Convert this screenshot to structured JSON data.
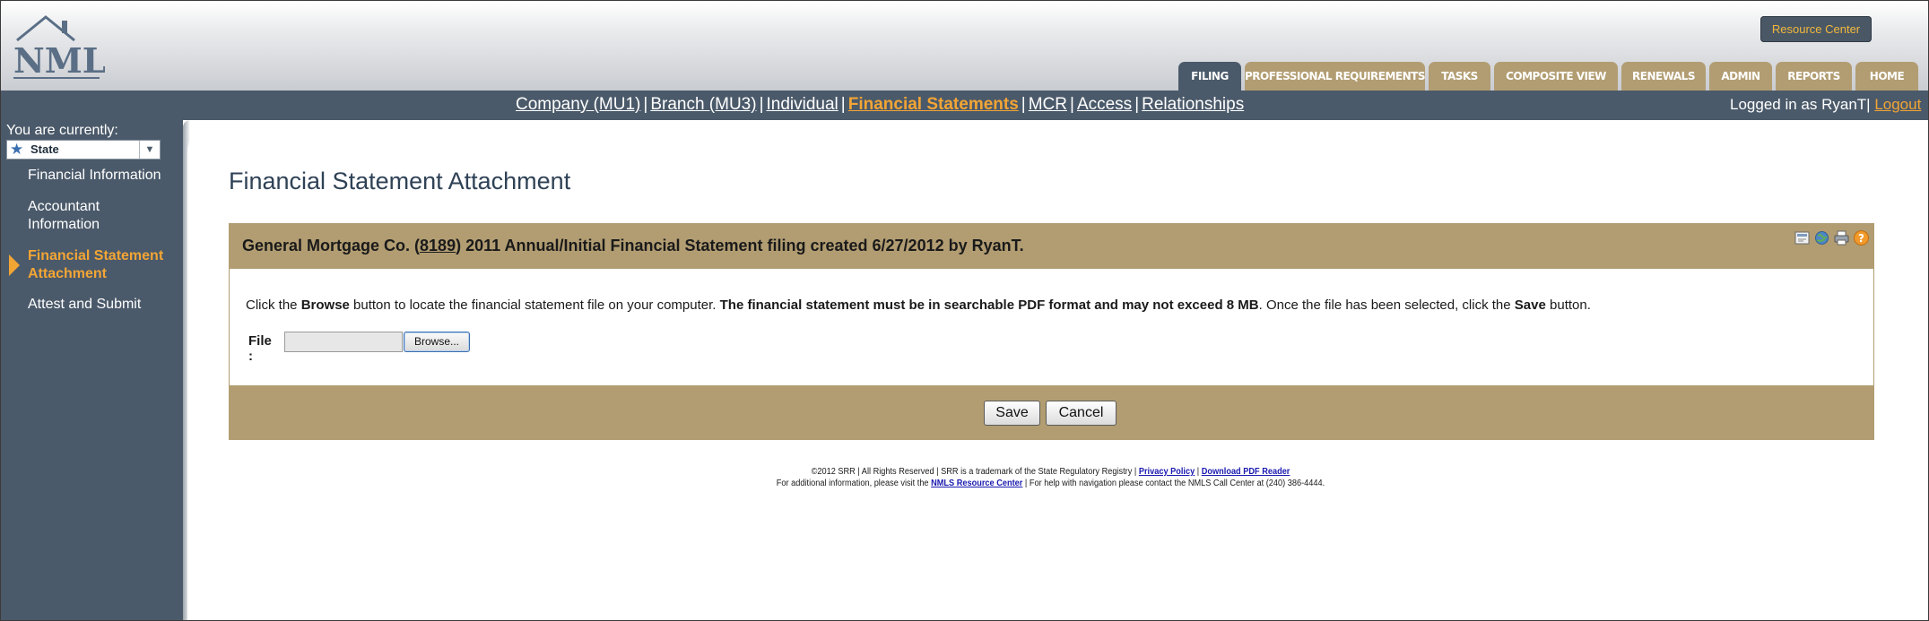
{
  "header": {
    "logo_text": "NMLS",
    "resource_center": "Resource Center",
    "tabs": [
      {
        "label": "FILING",
        "active": true
      },
      {
        "label": "PROFESSIONAL REQUIREMENTS"
      },
      {
        "label": "TASKS"
      },
      {
        "label": "COMPOSITE VIEW"
      },
      {
        "label": "RENEWALS"
      },
      {
        "label": "ADMIN"
      },
      {
        "label": "REPORTS"
      },
      {
        "label": "HOME"
      }
    ]
  },
  "subnav": {
    "items": [
      "Company (MU1)",
      "Branch (MU3)",
      "Individual",
      "Financial Statements",
      "MCR",
      "Access",
      "Relationships"
    ],
    "current": "Financial Statements",
    "separator": "|"
  },
  "login": {
    "text": "Logged in as RyanT",
    "separator": "|",
    "logout": "Logout"
  },
  "sidebar": {
    "current_label": "You are currently:",
    "state_value": "State",
    "items": [
      {
        "label": "Financial Information"
      },
      {
        "label": "Accountant Information"
      },
      {
        "label": "Financial Statement Attachment",
        "active": true
      },
      {
        "label": "Attest and Submit"
      }
    ]
  },
  "main": {
    "title": "Financial Statement Attachment",
    "panel": {
      "heading_pre": "General Mortgage Co. (",
      "heading_link": "8189",
      "heading_post": ") 2011 Annual/Initial Financial Statement filing created 6/27/2012 by RyanT.",
      "instr_1": "Click the ",
      "instr_browse": "Browse",
      "instr_2": " button to locate the financial statement file on your computer. ",
      "instr_bold": "The financial statement must be in searchable PDF format and may not exceed 8 MB",
      "instr_3": ". Once the file has been selected, click the ",
      "instr_save": "Save",
      "instr_4": " button.",
      "file_label": "File :",
      "file_value": "",
      "browse_label": "Browse...",
      "save_label": "Save",
      "cancel_label": "Cancel",
      "icons": [
        "expand-icon",
        "globe-icon",
        "print-icon",
        "help-icon"
      ]
    }
  },
  "footer": {
    "line1_text": "©2012 SRR | All Rights Reserved | SRR is a trademark of the State Regulatory Registry | ",
    "privacy": "Privacy Policy",
    "line1_sep": " | ",
    "pdf_reader": "Download PDF Reader",
    "line2_pre": "For additional information, please visit the ",
    "resource_link": "NMLS Resource Center",
    "line2_post": " | For help with navigation please contact the NMLS Call Center at (240) 386-4444."
  },
  "colors": {
    "nav_bg": "#4b5a6a",
    "tan": "#b29d72",
    "accent_orange": "#f3a534"
  }
}
